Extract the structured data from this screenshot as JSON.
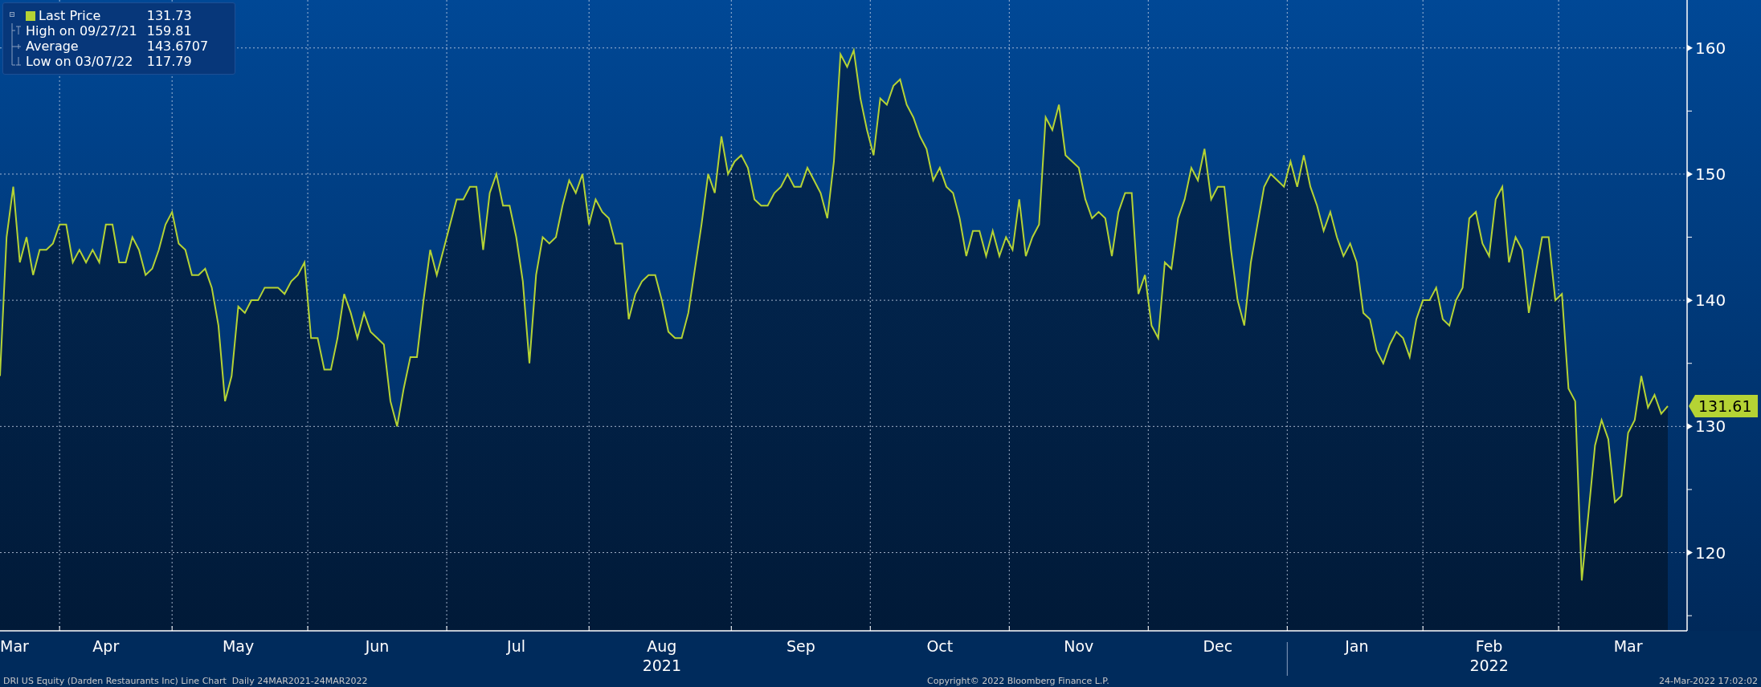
{
  "legend": {
    "items": [
      {
        "kind": "last",
        "value": "131.73"
      },
      {
        "kind": "high",
        "label": "High on 09/27/21",
        "value": "159.81"
      },
      {
        "kind": "average",
        "label": "Average",
        "value": "143.6707"
      },
      {
        "kind": "low",
        "label": "Low on 03/07/22",
        "value": "117.79"
      }
    ]
  },
  "chart_data": {
    "type": "area",
    "grid": true,
    "ylim": [
      113.8,
      163.8
    ],
    "yticks": [
      120,
      130,
      140,
      150,
      160
    ],
    "categories": [
      null,
      null,
      "Mar",
      null,
      null,
      null,
      null,
      null,
      null,
      null,
      null,
      null,
      null,
      null,
      null,
      null,
      "Apr",
      null,
      null,
      null,
      null,
      null,
      null,
      null,
      null,
      null,
      null,
      null,
      null,
      null,
      null,
      null,
      null,
      null,
      null,
      null,
      "May",
      null,
      null,
      null,
      null,
      null,
      null,
      null,
      null,
      null,
      null,
      null,
      null,
      null,
      null,
      null,
      null,
      null,
      null,
      null,
      null,
      "Jun",
      null,
      null,
      null,
      null,
      null,
      null,
      null,
      null,
      null,
      null,
      null,
      null,
      null,
      null,
      null,
      null,
      null,
      null,
      null,
      null,
      "Jul",
      null,
      null,
      null,
      null,
      null,
      null,
      null,
      null,
      null,
      null,
      null,
      null,
      null,
      null,
      null,
      null,
      null,
      null,
      null,
      null,
      null,
      "Aug",
      null,
      null,
      null,
      null,
      null,
      null,
      null,
      null,
      null,
      null,
      null,
      null,
      null,
      null,
      null,
      null,
      null,
      null,
      null,
      null,
      "Sep",
      null,
      null,
      null,
      null,
      null,
      null,
      null,
      null,
      null,
      null,
      null,
      null,
      null,
      null,
      null,
      null,
      null,
      null,
      null,
      null,
      "Oct",
      null,
      null,
      null,
      null,
      null,
      null,
      null,
      null,
      null,
      null,
      null,
      null,
      null,
      null,
      null,
      null,
      null,
      null,
      null,
      null,
      "Nov",
      null,
      null,
      null,
      null,
      null,
      null,
      null,
      null,
      null,
      null,
      null,
      null,
      null,
      null,
      null,
      null,
      null,
      null,
      null,
      null,
      "Dec",
      null,
      null,
      null,
      null,
      null,
      null,
      null,
      null,
      null,
      null,
      null,
      null,
      null,
      null,
      null,
      null,
      null,
      null,
      null,
      null,
      "Jan",
      null,
      null,
      null,
      null,
      null,
      null,
      null,
      null,
      null,
      null,
      null,
      null,
      null,
      null,
      null,
      null,
      null,
      null,
      null,
      "Feb",
      null,
      null,
      null,
      null,
      null,
      null,
      null,
      null,
      null,
      null,
      null,
      null,
      null,
      null,
      null,
      null,
      null,
      null,
      null,
      null,
      "Mar",
      null,
      null,
      null,
      null,
      null,
      null
    ],
    "series": [
      {
        "name": "Last Price",
        "color": "#b5d334",
        "values": [
          134,
          145,
          149,
          143,
          145,
          142,
          144,
          144,
          144.5,
          146,
          146,
          143,
          144,
          143,
          144,
          143,
          146,
          146,
          143,
          143,
          145,
          144,
          142,
          142.5,
          144,
          146,
          147,
          144.5,
          144,
          142,
          142,
          142.5,
          141,
          138,
          132,
          134,
          139.5,
          139,
          140,
          140,
          141,
          141,
          141,
          140.5,
          141.5,
          142,
          143,
          137,
          137,
          134.5,
          134.5,
          137,
          140.5,
          139,
          137,
          139,
          137.5,
          137,
          136.5,
          132,
          130,
          133,
          135.5,
          135.5,
          140,
          144,
          142,
          144,
          146,
          148,
          148,
          149,
          149,
          144,
          148.5,
          150,
          147.5,
          147.5,
          145,
          141.5,
          135,
          142,
          145,
          144.5,
          145,
          147.5,
          149.5,
          148.5,
          150,
          146,
          148,
          147,
          146.5,
          144.5,
          144.5,
          138.5,
          140.5,
          141.5,
          142,
          142,
          140,
          137.5,
          137,
          137,
          139,
          142.5,
          146,
          150,
          148.5,
          153,
          150,
          151,
          151.5,
          150.5,
          148,
          147.5,
          147.5,
          148.5,
          149,
          150,
          149,
          149,
          150.5,
          149.5,
          148.5,
          146.5,
          151,
          159.5,
          158.5,
          159.81,
          156,
          153.5,
          151.5,
          156,
          155.5,
          157,
          157.5,
          155.5,
          154.5,
          153,
          152,
          149.5,
          150.5,
          149,
          148.5,
          146.5,
          143.5,
          145.5,
          145.5,
          143.5,
          145.5,
          143.5,
          145,
          144,
          148,
          143.5,
          145,
          146,
          154.5,
          153.5,
          155.5,
          151.5,
          151,
          150.5,
          148,
          146.5,
          147,
          146.5,
          143.5,
          147,
          148.5,
          148.5,
          140.5,
          142,
          138,
          137,
          143,
          142.5,
          146.5,
          148,
          150.5,
          149.5,
          152,
          148,
          149,
          149,
          144,
          140,
          138,
          143,
          146,
          149,
          150,
          149.5,
          149,
          151,
          149,
          151.5,
          149,
          147.5,
          145.5,
          147,
          145,
          143.5,
          144.5,
          143,
          139,
          138.5,
          136,
          135,
          136.5,
          137.5,
          137,
          135.5,
          138.5,
          140,
          140,
          141,
          138.5,
          138,
          140,
          141,
          146.5,
          147,
          144.5,
          143.5,
          148,
          149,
          143,
          145,
          144,
          139,
          142,
          145,
          145,
          140,
          140.5,
          133,
          132,
          117.79,
          123,
          128.5,
          130.5,
          129,
          124,
          124.5,
          129.5,
          130.5,
          134,
          131.5,
          132.5,
          131,
          131.61
        ]
      }
    ]
  },
  "year_labels": [
    {
      "label": "2021"
    },
    {
      "label": "2022"
    }
  ],
  "last_tag": "131.61",
  "footer": {
    "description": "DRI US Equity (Darden Restaurants Inc) Line Chart  Daily 24MAR2021-24MAR2022",
    "copyright": "Copyright© 2022 Bloomberg Finance L.P.",
    "timestamp": "24-Mar-2022 17:02:02"
  }
}
